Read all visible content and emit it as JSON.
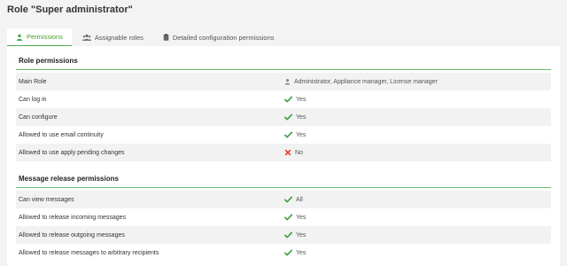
{
  "page": {
    "title": "Role \"Super administrator\""
  },
  "tabs": [
    {
      "label": "Permissions",
      "icon": "user-icon",
      "active": true
    },
    {
      "label": "Assignable roles",
      "icon": "users-icon",
      "active": false
    },
    {
      "label": "Detailed configuration permissions",
      "icon": "clipboard-icon",
      "active": false
    }
  ],
  "sections": [
    {
      "title": "Role permissions",
      "rows": [
        {
          "label": "Main Role",
          "value": "Administrator, Appliance manager, License manager",
          "icon": "user-icon"
        },
        {
          "label": "Can log in",
          "value": "Yes",
          "icon": "check-icon"
        },
        {
          "label": "Can configure",
          "value": "Yes",
          "icon": "check-icon"
        },
        {
          "label": "Allowed to use email continuity",
          "value": "Yes",
          "icon": "check-icon"
        },
        {
          "label": "Allowed to use apply pending changes",
          "value": "No",
          "icon": "cross-icon"
        }
      ]
    },
    {
      "title": "Message release permissions",
      "rows": [
        {
          "label": "Can view messages",
          "value": "All",
          "icon": "check-icon"
        },
        {
          "label": "Allowed to release incoming messages",
          "value": "Yes",
          "icon": "check-icon"
        },
        {
          "label": "Allowed to release outgoing messages",
          "value": "Yes",
          "icon": "check-icon"
        },
        {
          "label": "Allowed to release messages to arbitrary recipients",
          "value": "Yes",
          "icon": "check-icon"
        }
      ]
    }
  ],
  "colors": {
    "accent": "#4caf50",
    "check": "#43a047",
    "cross": "#e53935",
    "alt_row": "#f2f2f2",
    "background": "#f3f3f3"
  }
}
